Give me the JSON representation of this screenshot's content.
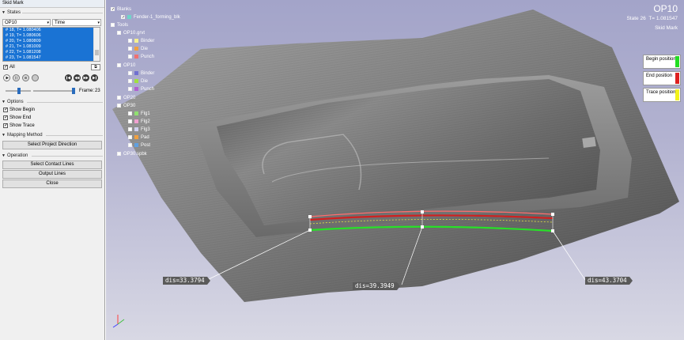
{
  "window": {
    "title": "Skid Mark"
  },
  "states": {
    "section": "States",
    "op_value": "OP10",
    "mode_value": "Time",
    "rows": [
      "#   18, T= 1.080406",
      "#   19, T= 1.080606",
      "#   20, T= 1.080809",
      "#   21, T= 1.081009",
      "#   22, T= 1.081208",
      "#   23, T= 1.081547"
    ],
    "all_label": "All",
    "frame_label": "Frame:",
    "frame_value": "23"
  },
  "options": {
    "section": "Options",
    "show_begin": "Show Begin",
    "show_end": "Show End",
    "show_trace": "Show Trace"
  },
  "mapping": {
    "section": "Mapping Method",
    "button": "Select Project Direction"
  },
  "operation": {
    "section": "Operation",
    "contact_button": "Select Contact Lines",
    "output_button": "Output Lines",
    "close_button": "Close"
  },
  "viewport": {
    "op_title": "OP10",
    "state_label": "State 26",
    "time_label": "T= 1.081547",
    "mode_label": "Skid Mark",
    "tree": {
      "blanks": "Blanks",
      "blank_item": "Fender-1_forming_blk",
      "tools": "Tools",
      "op10grvt": "OP10.grvt",
      "op10": "OP10",
      "op20": "OP20",
      "op30": "OP30",
      "op30spbk": "OP30.spbk",
      "binder": "Binder",
      "die": "Die",
      "punch": "Punch",
      "flg1": "Flg1",
      "flg2": "Flg2",
      "flg3": "Flg3",
      "pad": "Pad",
      "post": "Post"
    },
    "legend": {
      "begin": "Begin position",
      "end": "End position",
      "trace": "Trace position"
    },
    "colors": {
      "begin": "#22dd22",
      "end": "#dd2020",
      "trace": "#f2f21a"
    },
    "dis1": "dis=33.3794",
    "dis2": "dis=39.3949",
    "dis3": "dis=43.3704"
  }
}
